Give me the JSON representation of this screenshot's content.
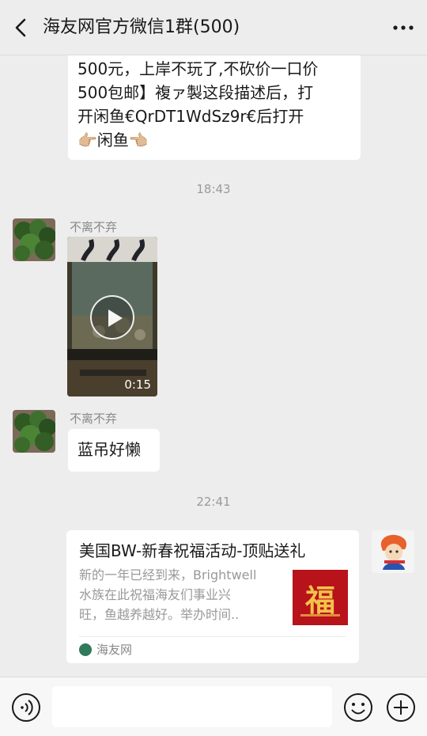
{
  "header": {
    "title": "海友网官方微信1群(500)"
  },
  "messages": {
    "first_text_lines": [
      "500元，上岸不玩了,不砍价一口价",
      "500包邮】複ァ製这段描述后，打",
      "开闲鱼€QrDT1WdSz9r€后打开",
      "👉🏼闲鱼👈🏼"
    ],
    "timestamp1": "18:43",
    "video_sender": "不离不弃",
    "video_duration": "0:15",
    "text_sender": "不离不弃",
    "text_message": "蓝吊好懒",
    "timestamp2": "22:41",
    "link_card": {
      "title": "美国BW-新春祝福活动-顶贴送礼",
      "desc_lines": [
        "新的一年已经到来，Brightwell",
        "水族在此祝福海友们事业兴",
        "旺，鱼越养越好。举办时间.."
      ],
      "thumb_char": "福",
      "source": "海友网"
    }
  },
  "input": {
    "placeholder": ""
  },
  "colors": {
    "bg": "#ededed",
    "bubble": "#ffffff",
    "thumb": "#b8121a"
  }
}
